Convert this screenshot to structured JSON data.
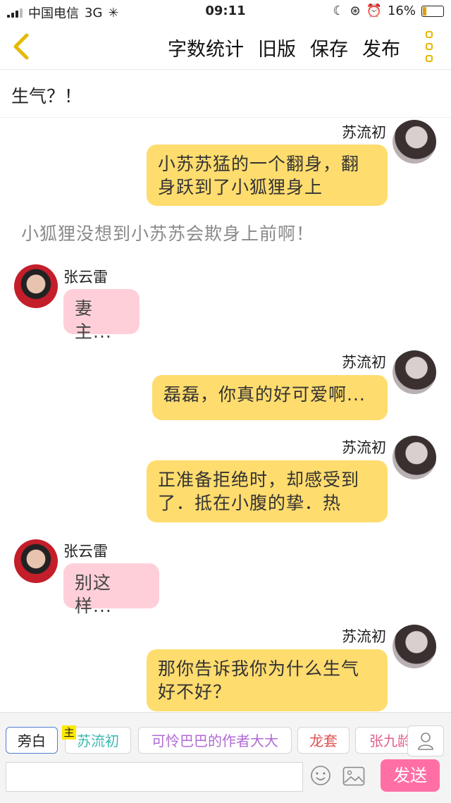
{
  "status_bar": {
    "carrier": "中国电信",
    "network": "3G",
    "time": "09:11",
    "battery": "16%"
  },
  "navbar": {
    "word_count": "字数统计",
    "old_version": "旧版",
    "save": "保存",
    "publish": "发布"
  },
  "chapter_title": "生气？！",
  "messages": [
    {
      "type": "right",
      "name": "苏流初",
      "lines": [
        "小苏苏猛的一个翻身，翻",
        "身跃到了小狐狸身上"
      ]
    },
    {
      "type": "narration",
      "text": "小狐狸没想到小苏苏会欺身上前啊！"
    },
    {
      "type": "left",
      "name": "张云雷",
      "lines": [
        "妻主..."
      ]
    },
    {
      "type": "right",
      "name": "苏流初",
      "lines": [
        "磊磊，你真的好可爱啊..."
      ]
    },
    {
      "type": "right",
      "name": "苏流初",
      "lines": [
        "正准备拒绝时，却感受到",
        "了．抵在小腹的挚．热"
      ]
    },
    {
      "type": "left",
      "name": "张云雷",
      "lines": [
        "别这样..."
      ]
    },
    {
      "type": "right",
      "name": "苏流初",
      "lines": [
        "那你告诉我你为什么生气",
        "好不好？"
      ]
    }
  ],
  "roles": {
    "narrator": "旁白",
    "main_badge": "主",
    "items": [
      "苏流初",
      "可怜巴巴的作者大大",
      "龙套",
      "张九龄"
    ],
    "colors": [
      "#3cb8b0",
      "#b06ad6",
      "#e05050",
      "#e0608a"
    ]
  },
  "send_label": "发送",
  "colors": {
    "accent_yellow": "#ffdc6e",
    "pink_bubble": "#ffcfd9",
    "send_button": "#ff6fa6"
  }
}
